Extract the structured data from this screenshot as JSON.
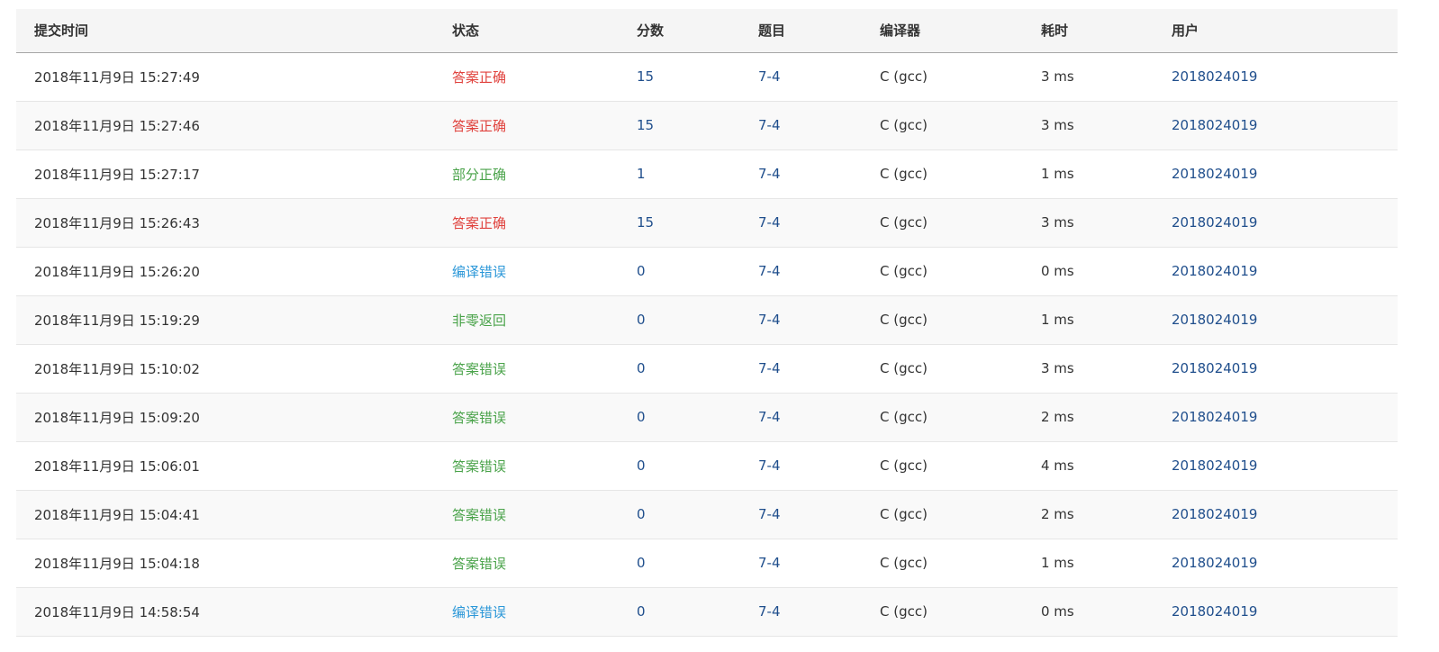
{
  "columns": {
    "time": "提交时间",
    "status": "状态",
    "score": "分数",
    "problem": "题目",
    "compiler": "编译器",
    "cost": "耗时",
    "user": "用户"
  },
  "status_colors": {
    "答案正确": "#e0413c",
    "部分正确": "#4aa34a",
    "非零返回": "#4aa34a",
    "答案错误": "#4aa34a",
    "编译错误": "#2b97d8"
  },
  "rows": [
    {
      "time": "2018年11月9日 15:27:49",
      "status": "答案正确",
      "score": "15",
      "problem": "7-4",
      "compiler": "C (gcc)",
      "cost": "3 ms",
      "user": "2018024019"
    },
    {
      "time": "2018年11月9日 15:27:46",
      "status": "答案正确",
      "score": "15",
      "problem": "7-4",
      "compiler": "C (gcc)",
      "cost": "3 ms",
      "user": "2018024019"
    },
    {
      "time": "2018年11月9日 15:27:17",
      "status": "部分正确",
      "score": "1",
      "problem": "7-4",
      "compiler": "C (gcc)",
      "cost": "1 ms",
      "user": "2018024019"
    },
    {
      "time": "2018年11月9日 15:26:43",
      "status": "答案正确",
      "score": "15",
      "problem": "7-4",
      "compiler": "C (gcc)",
      "cost": "3 ms",
      "user": "2018024019"
    },
    {
      "time": "2018年11月9日 15:26:20",
      "status": "编译错误",
      "score": "0",
      "problem": "7-4",
      "compiler": "C (gcc)",
      "cost": "0 ms",
      "user": "2018024019"
    },
    {
      "time": "2018年11月9日 15:19:29",
      "status": "非零返回",
      "score": "0",
      "problem": "7-4",
      "compiler": "C (gcc)",
      "cost": "1 ms",
      "user": "2018024019"
    },
    {
      "time": "2018年11月9日 15:10:02",
      "status": "答案错误",
      "score": "0",
      "problem": "7-4",
      "compiler": "C (gcc)",
      "cost": "3 ms",
      "user": "2018024019"
    },
    {
      "time": "2018年11月9日 15:09:20",
      "status": "答案错误",
      "score": "0",
      "problem": "7-4",
      "compiler": "C (gcc)",
      "cost": "2 ms",
      "user": "2018024019"
    },
    {
      "time": "2018年11月9日 15:06:01",
      "status": "答案错误",
      "score": "0",
      "problem": "7-4",
      "compiler": "C (gcc)",
      "cost": "4 ms",
      "user": "2018024019"
    },
    {
      "time": "2018年11月9日 15:04:41",
      "status": "答案错误",
      "score": "0",
      "problem": "7-4",
      "compiler": "C (gcc)",
      "cost": "2 ms",
      "user": "2018024019"
    },
    {
      "time": "2018年11月9日 15:04:18",
      "status": "答案错误",
      "score": "0",
      "problem": "7-4",
      "compiler": "C (gcc)",
      "cost": "1 ms",
      "user": "2018024019"
    },
    {
      "time": "2018年11月9日 14:58:54",
      "status": "编译错误",
      "score": "0",
      "problem": "7-4",
      "compiler": "C (gcc)",
      "cost": "0 ms",
      "user": "2018024019"
    }
  ]
}
